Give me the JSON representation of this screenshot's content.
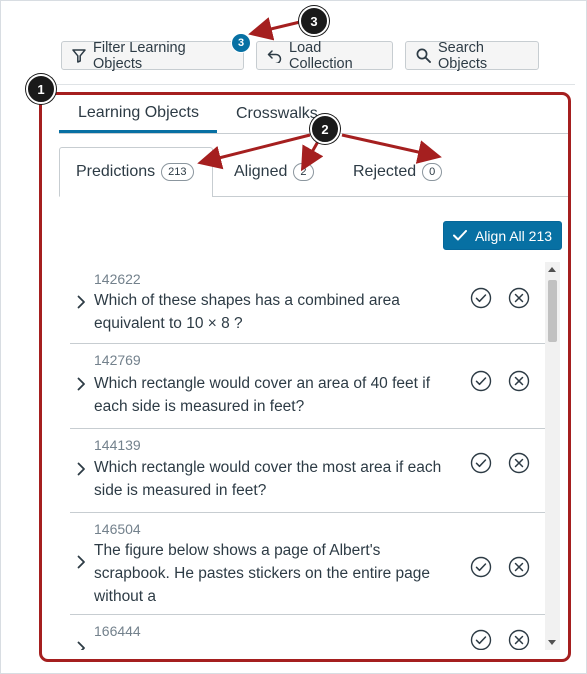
{
  "toolbar": {
    "filter_label": "Filter Learning Objects",
    "filter_badge": "3",
    "load_label": "Load Collection",
    "search_label": "Search Objects"
  },
  "tabs": {
    "learning_objects": "Learning Objects",
    "crosswalks": "Crosswalks"
  },
  "subtabs": {
    "predictions": {
      "label": "Predictions",
      "count": "213"
    },
    "aligned": {
      "label": "Aligned",
      "count": "2"
    },
    "rejected": {
      "label": "Rejected",
      "count": "0"
    }
  },
  "align_all": {
    "label": "Align All 213"
  },
  "items": [
    {
      "id": "142622",
      "line1": "Which of these shapes has a combined area",
      "line2": "equivalent to 10 × 8 ?",
      "line3": ""
    },
    {
      "id": "142769",
      "line1": "Which rectangle would cover an area of 40 feet if",
      "line2": "each side is measured in feet?",
      "line3": ""
    },
    {
      "id": "144139",
      "line1": "Which rectangle would cover the most area if each",
      "line2": "side is measured in feet?",
      "line3": ""
    },
    {
      "id": "146504",
      "line1": "The figure below shows a page of Albert's",
      "line2": "scrapbook. He pastes stickers on the entire page",
      "line3": "without a"
    },
    {
      "id": "166444",
      "line1": "",
      "line2": "",
      "line3": ""
    }
  ],
  "markers": {
    "m1": "1",
    "m2": "2",
    "m3": "3"
  },
  "colors": {
    "accent": "#0770a3",
    "callout": "#a51f1f"
  }
}
